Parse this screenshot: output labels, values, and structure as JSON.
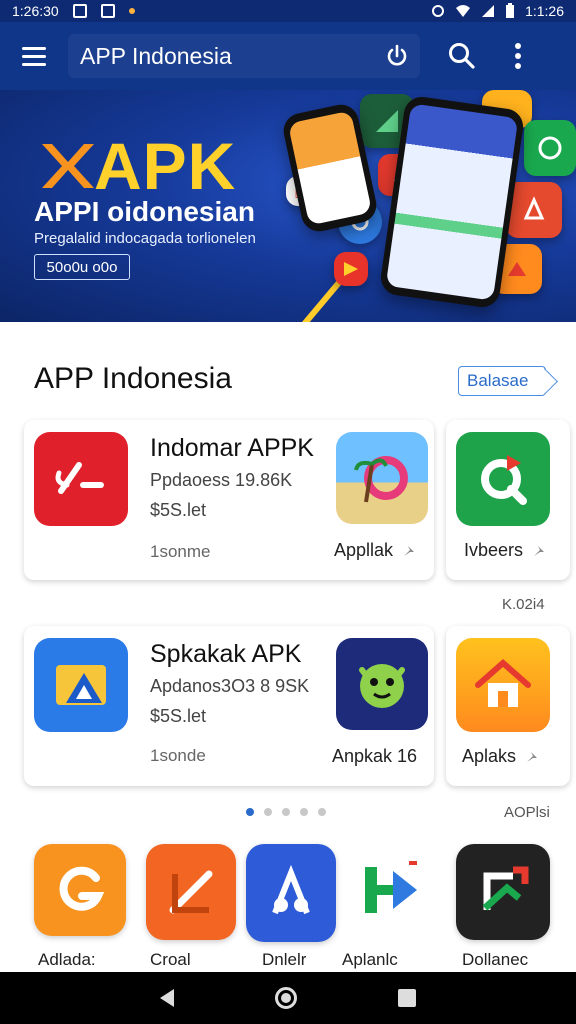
{
  "status_bar": {
    "time_left": "1:26:30",
    "time_right": "1:1:26"
  },
  "app_bar": {
    "search_text": "APP Indonesia"
  },
  "banner": {
    "title": "APK",
    "heading": "APPI oidonesian",
    "tagline": "Pregalalid indocagada torlionelen",
    "chip": "50o0u o0o"
  },
  "section": {
    "title": "APP Indonesia",
    "more_label": "Balasae"
  },
  "card1": {
    "title": "Indomar APPK",
    "meta": "Ppdaoess 19.86K",
    "price": "$5S.let",
    "foot": "1sonme",
    "side_apps": [
      {
        "label": "Appllak"
      },
      {
        "label": "Ivbeers"
      }
    ]
  },
  "side_note_1": "K.02i4",
  "card2": {
    "title": "Spkakak APK",
    "meta": "Apdanos3O3 8 9SK",
    "price": "$5S.let",
    "foot": "1sonde",
    "side_apps": [
      {
        "label": "Anpkak 16"
      },
      {
        "label": "Aplaks"
      }
    ]
  },
  "side_note_2": "AOPlsi",
  "pagination": {
    "count": 5,
    "active": 0
  },
  "bottom_row": [
    {
      "label": "Adlada:",
      "color": "#f7931e"
    },
    {
      "label": "Croal",
      "color": "#f26522"
    },
    {
      "label": "Dnlelr",
      "color": "#2e5bd8"
    },
    {
      "label": "Aplanlc",
      "color": "#ffffff"
    },
    {
      "label": "Dollanec",
      "color": "#222222"
    }
  ],
  "colors": {
    "primary": "#10368a",
    "accent": "#2a6bc9",
    "banner_title": "#ffd12a"
  },
  "icons": [
    "menu-icon",
    "power-icon",
    "search-icon",
    "more-vert-icon",
    "pin-icon",
    "back-icon",
    "home-icon",
    "recent-apps-icon"
  ]
}
